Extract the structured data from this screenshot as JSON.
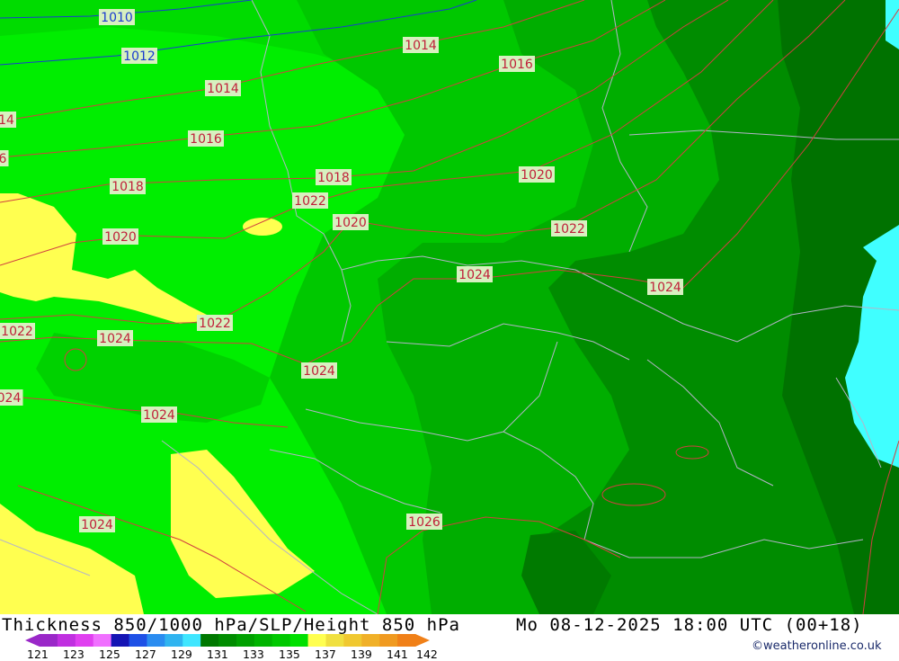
{
  "map": {
    "isobar_labels": [
      {
        "text": "1010",
        "color": "blue"
      },
      {
        "text": "1012",
        "color": "blue"
      },
      {
        "text": "1014",
        "color": "red"
      },
      {
        "text": "1016",
        "color": "red"
      },
      {
        "text": "1014",
        "color": "red"
      },
      {
        "text": "14",
        "color": "red"
      },
      {
        "text": "1016",
        "color": "red"
      },
      {
        "text": "6",
        "color": "red"
      },
      {
        "text": "1018",
        "color": "red"
      },
      {
        "text": "1018",
        "color": "red"
      },
      {
        "text": "1020",
        "color": "red"
      },
      {
        "text": "1020",
        "color": "red"
      },
      {
        "text": "1022",
        "color": "red"
      },
      {
        "text": "1020",
        "color": "red"
      },
      {
        "text": "1022",
        "color": "red"
      },
      {
        "text": "1024",
        "color": "red"
      },
      {
        "text": "1024",
        "color": "red"
      },
      {
        "text": "1022",
        "color": "red"
      },
      {
        "text": "1022",
        "color": "red"
      },
      {
        "text": "1024",
        "color": "red"
      },
      {
        "text": "1024",
        "color": "red"
      },
      {
        "text": "024",
        "color": "red"
      },
      {
        "text": "1024",
        "color": "red"
      },
      {
        "text": "1024",
        "color": "red"
      },
      {
        "text": "1026",
        "color": "red"
      }
    ],
    "colors": {
      "bright_green": "#00ee00",
      "green": "#00c800",
      "mid_green": "#00ae00",
      "dark_green": "#008c00",
      "darker_green": "#007200",
      "yellow": "#ffff50",
      "cyan": "#40ffff",
      "isobar_red": "#d04040",
      "isobar_blue": "#1a3ccf",
      "border_gray": "#b4b4c8"
    }
  },
  "footer": {
    "title": "Thickness 850/1000 hPa/SLP/Height 850 hPa",
    "valid": "Mo 08-12-2025 18:00 UTC (00+18)",
    "credit": "©weatheronline.co.uk",
    "legend_ticks": [
      "121",
      "123",
      "125",
      "127",
      "129",
      "131",
      "133",
      "135",
      "137",
      "139",
      "141",
      "142"
    ],
    "legend_colors": [
      "#9a28c8",
      "#c030e0",
      "#e040f0",
      "#f070ff",
      "#1414b4",
      "#1e50e6",
      "#2a8cf0",
      "#30b4f0",
      "#40e6ff",
      "#007800",
      "#008c00",
      "#00a000",
      "#00b400",
      "#00c800",
      "#00e000",
      "#ffff50",
      "#f0e040",
      "#f0c830",
      "#f0b028",
      "#f09a20",
      "#f08018"
    ]
  }
}
